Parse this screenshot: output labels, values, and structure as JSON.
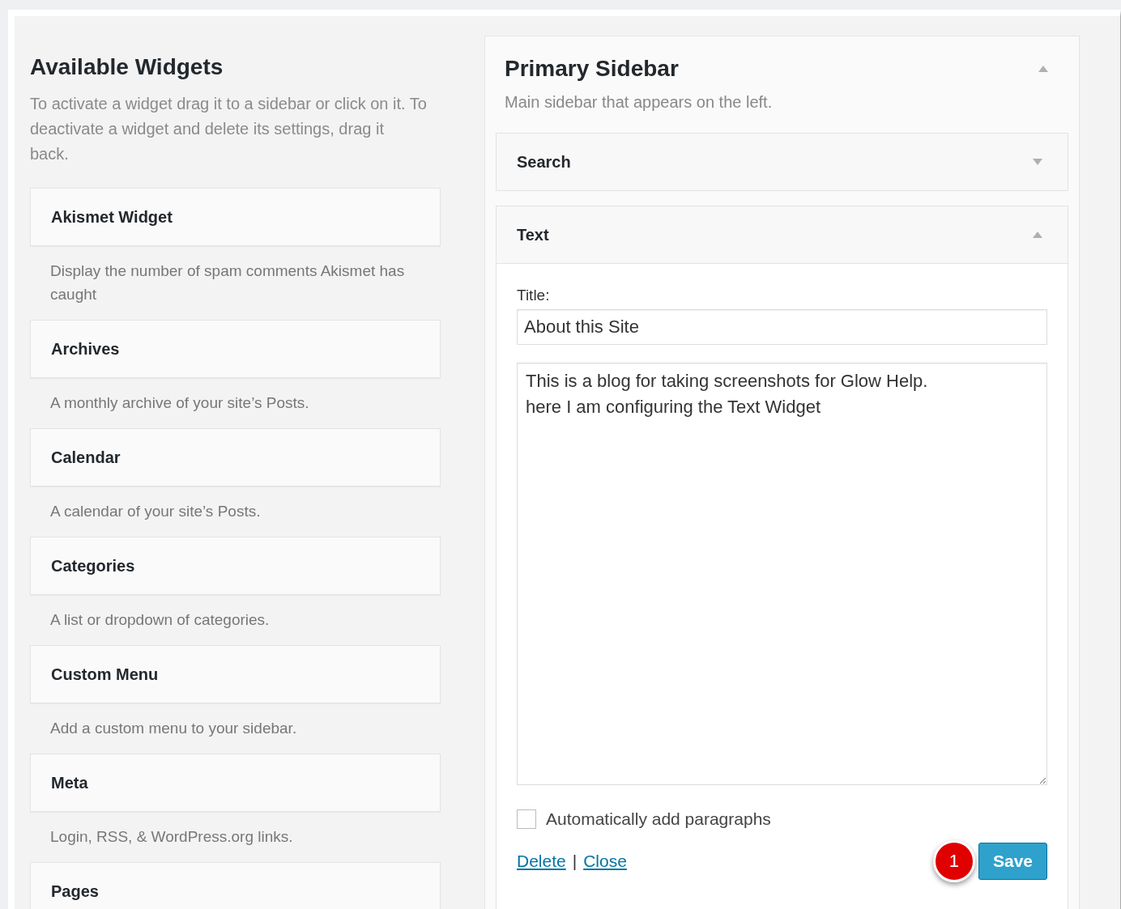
{
  "available_widgets": {
    "title": "Available Widgets",
    "description": "To activate a widget drag it to a sidebar or click on it. To deactivate a widget and delete its settings, drag it back.",
    "widgets": [
      {
        "name": "Akismet Widget",
        "description": "Display the number of spam comments Akismet has caught"
      },
      {
        "name": "Archives",
        "description": "A monthly archive of your site’s Posts."
      },
      {
        "name": "Calendar",
        "description": "A calendar of your site’s Posts."
      },
      {
        "name": "Categories",
        "description": "A list or dropdown of categories."
      },
      {
        "name": "Custom Menu",
        "description": "Add a custom menu to your sidebar."
      },
      {
        "name": "Meta",
        "description": "Login, RSS, & WordPress.org links."
      },
      {
        "name": "Pages"
      }
    ]
  },
  "primary_sidebar": {
    "title": "Primary Sidebar",
    "description": "Main sidebar that appears on the left.",
    "expanded": true,
    "widgets": [
      {
        "kind": "collapsed",
        "name": "Search",
        "expanded": false
      },
      {
        "kind": "form",
        "name": "Text",
        "expanded": true,
        "title_label": "Title:",
        "title_value": "About this Site",
        "text_value": "This is a blog for taking screenshots for Glow Help.\nhere I am configuring the Text Widget",
        "checkbox": {
          "label": "Automatically add paragraphs",
          "checked": false
        },
        "links": [
          "Delete",
          "Close"
        ],
        "link_separator": "|",
        "callout": "1",
        "save": "Save"
      }
    ]
  }
}
